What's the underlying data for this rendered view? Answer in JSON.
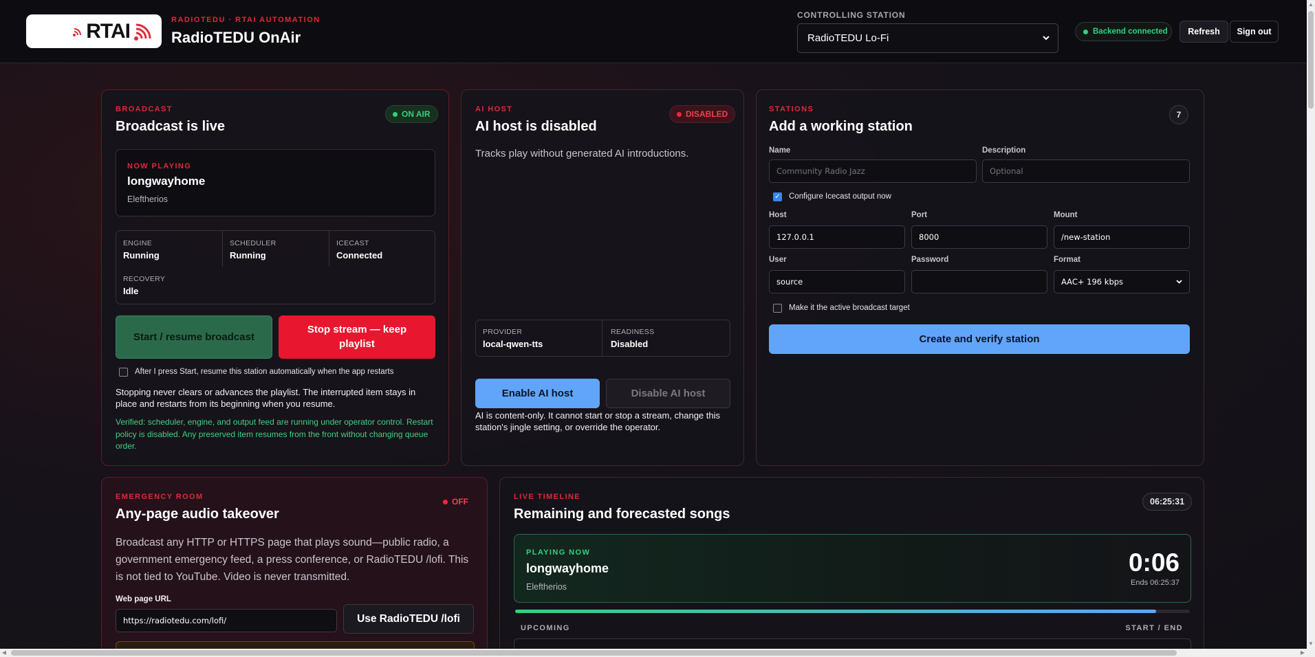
{
  "header": {
    "logo_text": "RTAI",
    "eyebrow": "RADIOTEDU · RTAI AUTOMATION",
    "title": "RadioTEDU OnAir",
    "controlling_label": "CONTROLLING STATION",
    "controlling_value": "RadioTEDU Lo-Fi",
    "backend_status": "Backend connected",
    "refresh_label": "Refresh",
    "signout_label": "Sign out"
  },
  "colors": {
    "accent_red": "#e0283a",
    "accent_green": "#35d07f",
    "accent_blue": "#60a5fa"
  },
  "broadcast": {
    "eyebrow": "BROADCAST",
    "title": "Broadcast is live",
    "status": "ON AIR",
    "now_playing_label": "NOW PLAYING",
    "track": "longwayhome",
    "artist": "Eleftherios",
    "stats": [
      {
        "label": "ENGINE",
        "value": "Running"
      },
      {
        "label": "SCHEDULER",
        "value": "Running"
      },
      {
        "label": "ICECAST",
        "value": "Connected"
      },
      {
        "label": "RECOVERY",
        "value": "Idle"
      }
    ],
    "start_label": "Start / resume broadcast",
    "stop_label": "Stop stream — keep playlist",
    "auto_resume_label": "After I press Start, resume this station automatically when the app restarts",
    "note": "Stopping never clears or advances the playlist. The interrupted item stays in place and restarts from its beginning when you resume.",
    "verified": "Verified: scheduler, engine, and output feed are running under operator control. Restart policy is disabled. Any preserved item resumes from the front without changing queue order."
  },
  "ai_host": {
    "eyebrow": "AI HOST",
    "title": "AI host is disabled",
    "status": "DISABLED",
    "description": "Tracks play without generated AI introductions.",
    "provider_label": "PROVIDER",
    "provider_value": "local-qwen-tts",
    "readiness_label": "READINESS",
    "readiness_value": "Disabled",
    "enable_label": "Enable AI host",
    "disable_label": "Disable AI host",
    "note": "AI is content-only. It cannot start or stop a stream, change this station's jingle setting, or override the operator."
  },
  "stations": {
    "eyebrow": "STATIONS",
    "title": "Add a working station",
    "count": "7",
    "name_label": "Name",
    "name_placeholder": "Community Radio Jazz",
    "desc_label": "Description",
    "desc_placeholder": "Optional",
    "icecast_label": "Configure Icecast output now",
    "host_label": "Host",
    "host_value": "127.0.0.1",
    "port_label": "Port",
    "port_value": "8000",
    "mount_label": "Mount",
    "mount_value": "/new-station",
    "user_label": "User",
    "user_value": "source",
    "password_label": "Password",
    "password_value": "",
    "format_label": "Format",
    "format_value": "AAC+ 196 kbps",
    "active_label": "Make it the active broadcast target",
    "create_label": "Create and verify station"
  },
  "emergency": {
    "eyebrow": "EMERGENCY ROOM",
    "title": "Any-page audio takeover",
    "status": "OFF",
    "description": "Broadcast any HTTP or HTTPS page that plays sound—public radio, a government emergency feed, a press conference, or RadioTEDU /lofi. This is not tied to YouTube. Video is never transmitted.",
    "url_label": "Web page URL",
    "url_value": "https://radiotedu.com/lofi/",
    "use_label": "Use RadioTEDU /lofi"
  },
  "timeline": {
    "eyebrow": "LIVE TIMELINE",
    "title": "Remaining and forecasted songs",
    "clock": "06:25:31",
    "playing_label": "PLAYING NOW",
    "track": "longwayhome",
    "artist": "Eleftherios",
    "elapsed": "0:06",
    "ends": "Ends 06:25:37",
    "progress": 0.95,
    "upcoming_label": "UPCOMING",
    "start_end_label": "START / END"
  }
}
